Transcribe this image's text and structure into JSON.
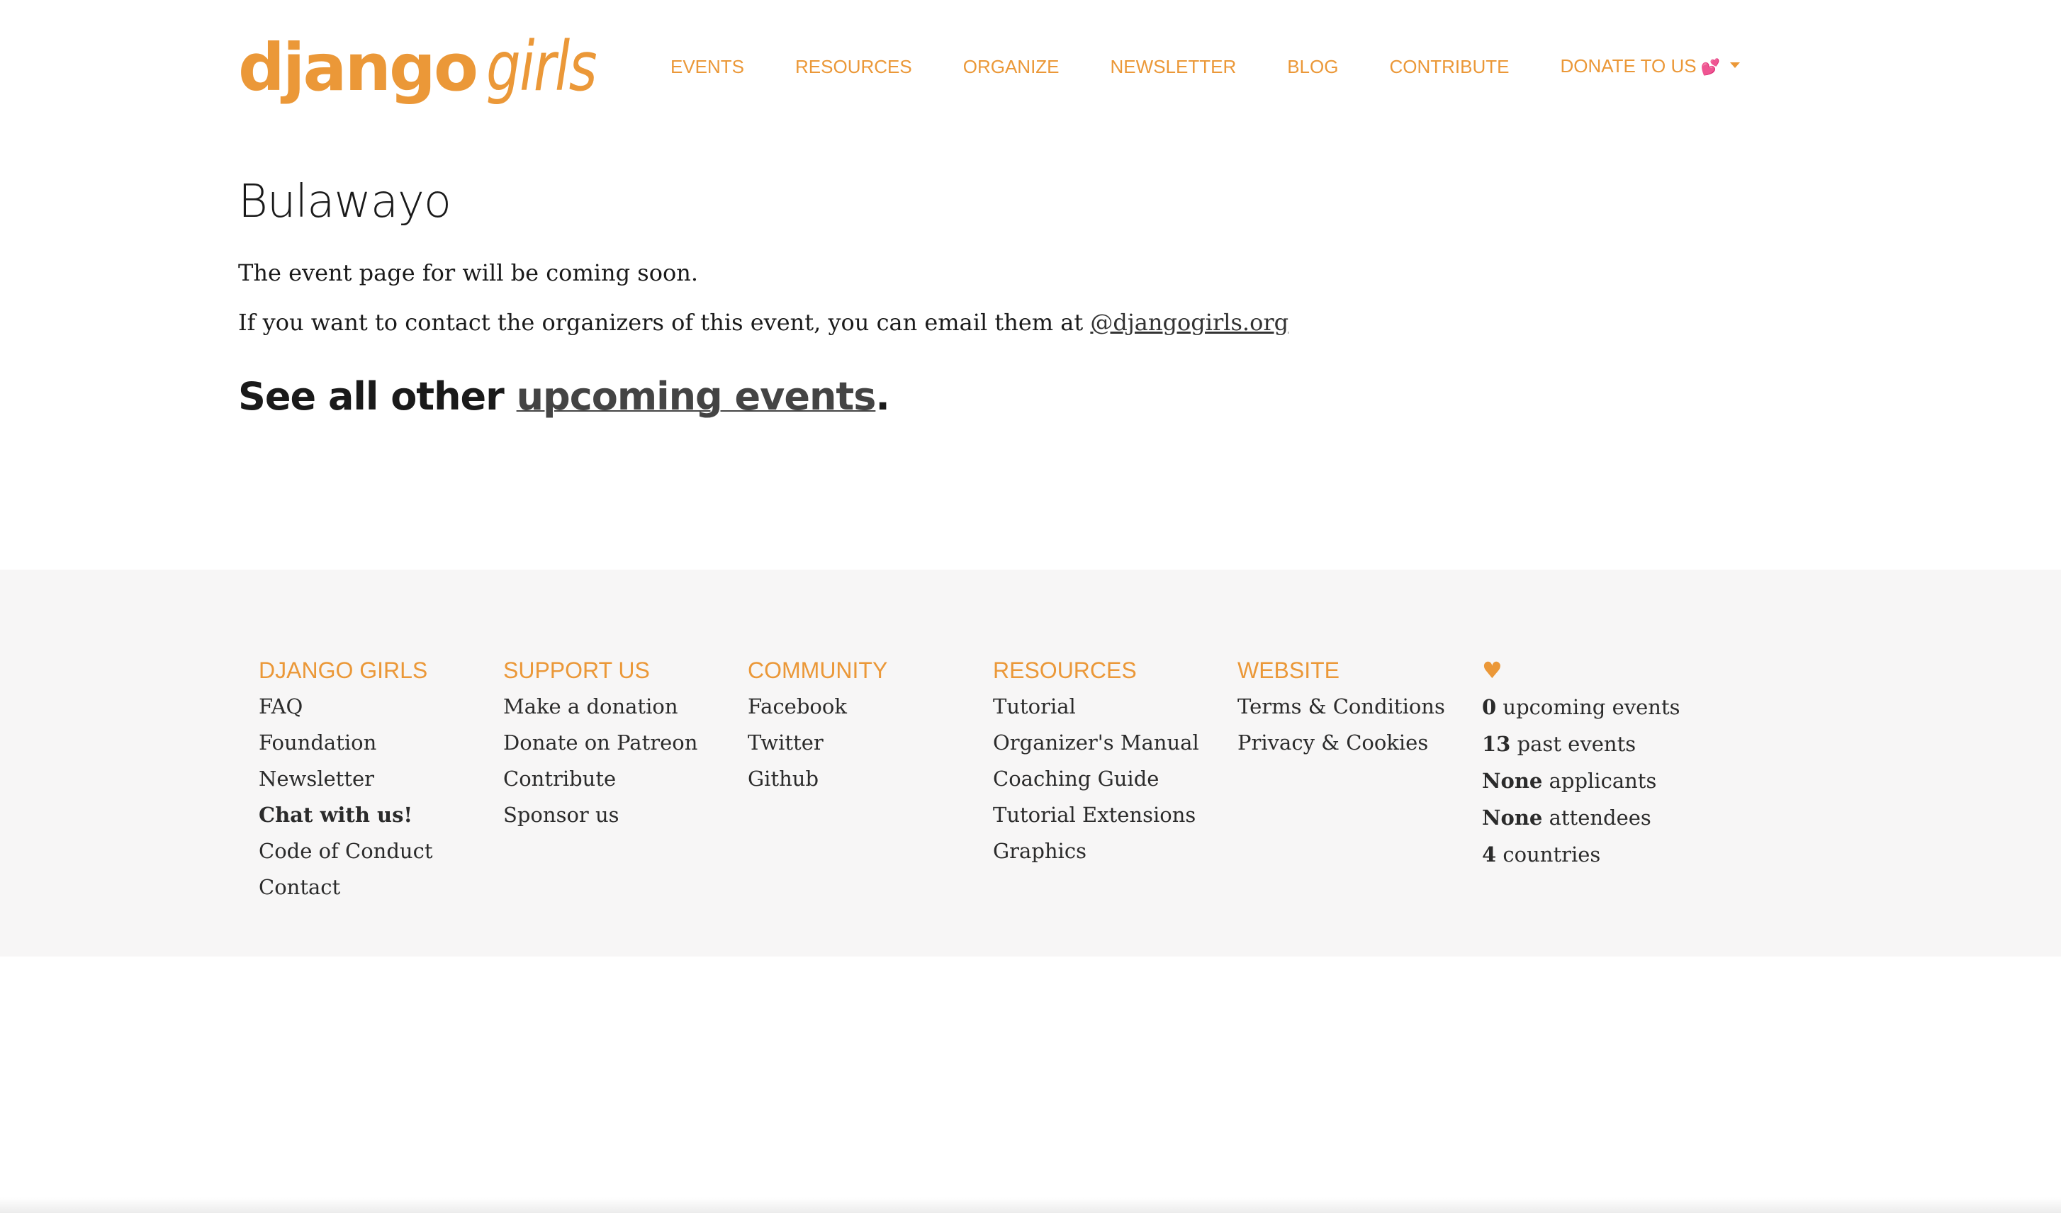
{
  "header": {
    "logo_django": "django",
    "logo_girls": "girls",
    "nav": [
      {
        "label": "EVENTS"
      },
      {
        "label": "RESOURCES"
      },
      {
        "label": "ORGANIZE"
      },
      {
        "label": "NEWSLETTER"
      },
      {
        "label": "BLOG"
      },
      {
        "label": "CONTRIBUTE"
      },
      {
        "label": "DONATE TO US",
        "emoji": "💕"
      }
    ]
  },
  "main": {
    "title": "Bulawayo",
    "coming_soon": "The event page for will be coming soon.",
    "contact_text": "If you want to contact the organizers of this event, you can email them at ",
    "contact_email": "@djangogirls.org",
    "see_all_prefix": "See all other ",
    "see_all_link": "upcoming events",
    "see_all_suffix": "."
  },
  "footer": {
    "columns": [
      {
        "heading": "DJANGO GIRLS",
        "links": [
          "FAQ",
          "Foundation",
          "Newsletter",
          "Chat with us!",
          "Code of Conduct",
          "Contact"
        ]
      },
      {
        "heading": "SUPPORT US",
        "links": [
          "Make a donation",
          "Donate on Patreon",
          "Contribute",
          "Sponsor us"
        ]
      },
      {
        "heading": "COMMUNITY",
        "links": [
          "Facebook",
          "Twitter",
          "Github"
        ]
      },
      {
        "heading": "RESOURCES",
        "links": [
          "Tutorial",
          "Organizer's Manual",
          "Coaching Guide",
          "Tutorial Extensions",
          "Graphics"
        ]
      },
      {
        "heading": "WEBSITE",
        "links": [
          "Terms & Conditions",
          "Privacy & Cookies"
        ]
      }
    ],
    "stats": {
      "heading": "♥",
      "items": [
        {
          "value": "0",
          "label": " upcoming events"
        },
        {
          "value": "13",
          "label": " past events"
        },
        {
          "value": "None",
          "label": " applicants"
        },
        {
          "value": "None",
          "label": " attendees"
        },
        {
          "value": "4",
          "label": " countries"
        }
      ]
    }
  },
  "colors": {
    "brand_orange": "#eb9838",
    "footer_bg": "#f7f6f6",
    "text": "#1a1a1a"
  }
}
